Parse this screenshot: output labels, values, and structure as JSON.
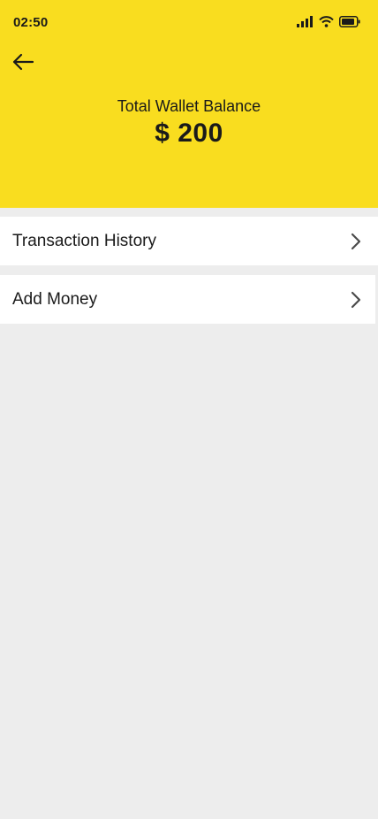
{
  "status_bar": {
    "time": "02:50",
    "icons": [
      "signal-icon",
      "wifi-icon",
      "battery-icon"
    ]
  },
  "header": {
    "back_icon": "arrow-left-icon",
    "background_color": "#f9dd1f"
  },
  "wallet": {
    "label": "Total Wallet Balance",
    "amount": "$ 200"
  },
  "menu": {
    "items": [
      {
        "label": "Transaction History",
        "icon": "chevron-right-icon"
      },
      {
        "label": "Add Money",
        "icon": "chevron-right-icon"
      }
    ]
  },
  "colors": {
    "accent": "#f9dd1f",
    "page_background": "#ededed",
    "card_background": "#ffffff",
    "text": "#1a1a1a"
  }
}
